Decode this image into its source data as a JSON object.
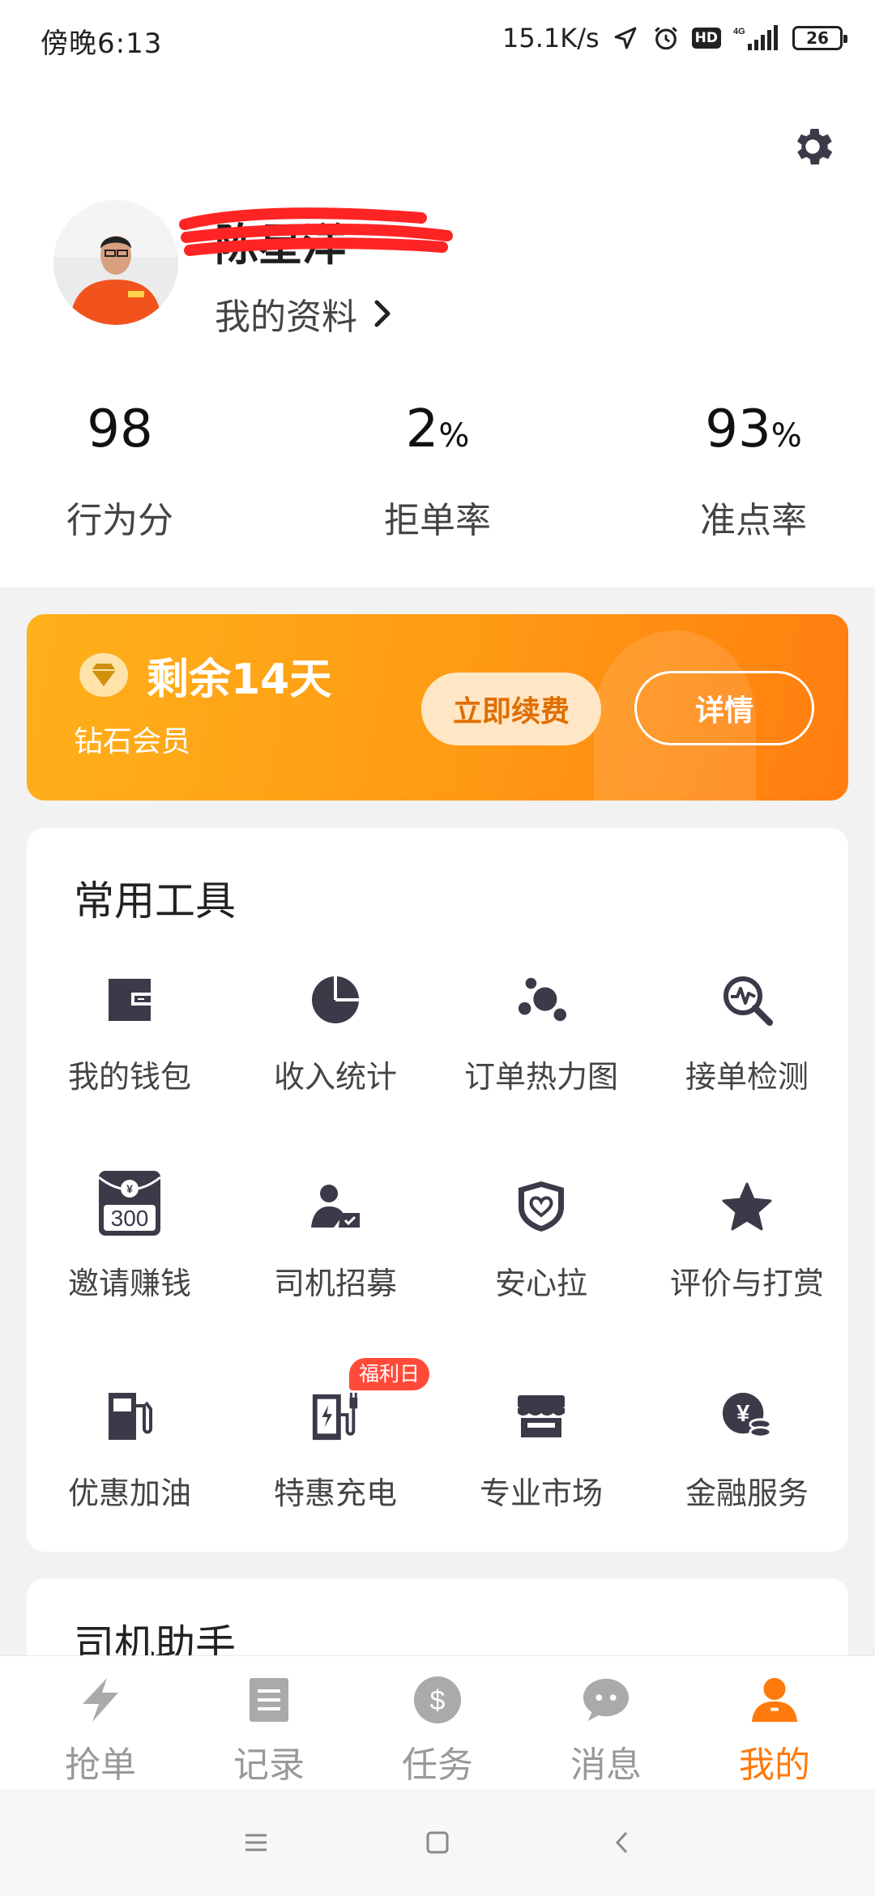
{
  "status_bar": {
    "time": "傍晚6:13",
    "net_speed": "15.1K/s",
    "hd": "HD",
    "network": "4G",
    "battery": "26"
  },
  "profile": {
    "name": "陈星洋",
    "profile_link": "我的资料"
  },
  "stats": [
    {
      "value": "98",
      "unit": "",
      "label": "行为分"
    },
    {
      "value": "2",
      "unit": "%",
      "label": "拒单率"
    },
    {
      "value": "93",
      "unit": "%",
      "label": "准点率"
    }
  ],
  "membership": {
    "title": "剩余14天",
    "subtitle": "钻石会员",
    "renew_label": "立即续费",
    "detail_label": "详情"
  },
  "tools": {
    "title": "常用工具",
    "items": [
      {
        "label": "我的钱包",
        "icon": "wallet-icon"
      },
      {
        "label": "收入统计",
        "icon": "pie-chart-icon"
      },
      {
        "label": "订单热力图",
        "icon": "heatmap-icon"
      },
      {
        "label": "接单检测",
        "icon": "detect-icon"
      },
      {
        "label": "邀请赚钱",
        "icon": "red-envelope-icon",
        "icon_text": "300",
        "icon_currency": "¥"
      },
      {
        "label": "司机招募",
        "icon": "recruit-icon"
      },
      {
        "label": "安心拉",
        "icon": "shield-heart-icon"
      },
      {
        "label": "评价与打赏",
        "icon": "star-icon"
      },
      {
        "label": "优惠加油",
        "icon": "fuel-icon"
      },
      {
        "label": "特惠充电",
        "icon": "charger-icon",
        "badge": "福利日"
      },
      {
        "label": "专业市场",
        "icon": "market-icon"
      },
      {
        "label": "金融服务",
        "icon": "finance-icon",
        "icon_currency": "¥"
      }
    ]
  },
  "helper": {
    "title": "司机助手"
  },
  "bottom_nav": [
    {
      "label": "抢单",
      "icon": "lightning-icon",
      "active": false
    },
    {
      "label": "记录",
      "icon": "list-icon",
      "active": false
    },
    {
      "label": "任务",
      "icon": "dollar-icon",
      "icon_text": "$",
      "active": false
    },
    {
      "label": "消息",
      "icon": "chat-icon",
      "active": false
    },
    {
      "label": "我的",
      "icon": "person-icon",
      "active": true
    }
  ],
  "colors": {
    "accent": "#ff7a0d",
    "icon_dark": "#3a3a48",
    "badge_red": "#ff4a3a",
    "nav_inactive": "#999999"
  }
}
